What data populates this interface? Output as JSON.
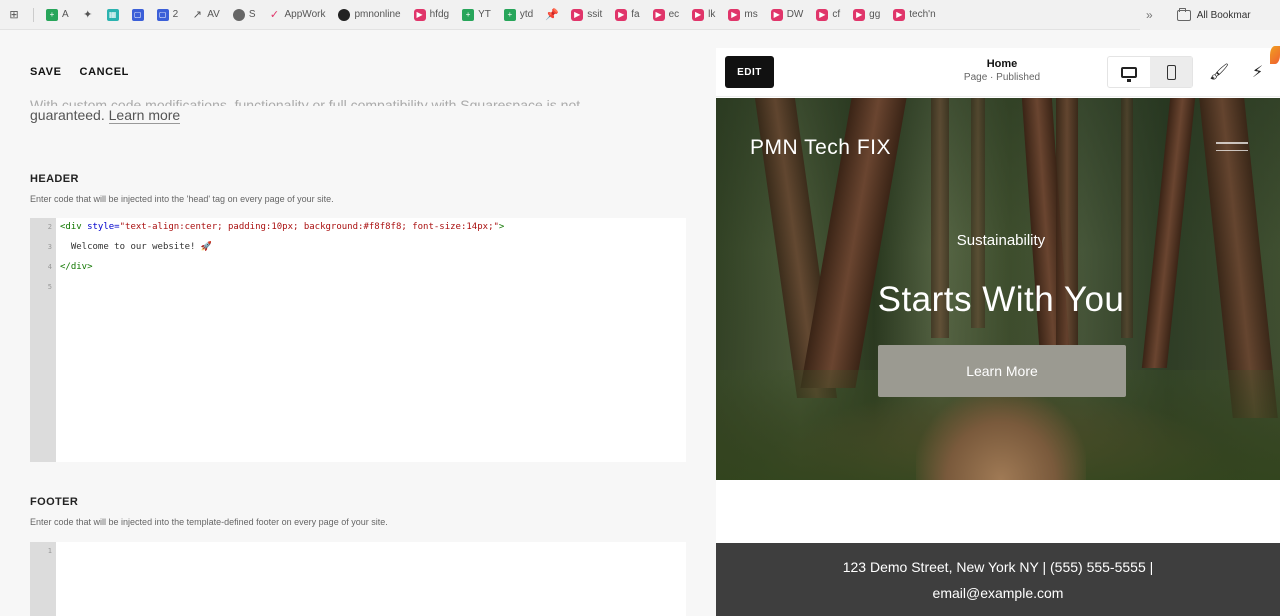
{
  "bookmarks": [
    {
      "label": "",
      "icon": "apps-icon",
      "kind": "gray",
      "glyph": "⊞"
    },
    {
      "label": "A",
      "icon": "sheets-icon",
      "kind": "green",
      "glyph": "+"
    },
    {
      "label": "",
      "icon": "puzzle-icon",
      "kind": "gray",
      "glyph": "✦"
    },
    {
      "label": "",
      "icon": "teal-icon",
      "kind": "teal",
      "glyph": "▦"
    },
    {
      "label": "",
      "icon": "chat-icon",
      "kind": "blue",
      "glyph": "▢"
    },
    {
      "label": "2",
      "icon": "chat-icon",
      "kind": "blue",
      "glyph": "▢"
    },
    {
      "label": "AV",
      "icon": "trend-icon",
      "kind": "gray",
      "glyph": "↗"
    },
    {
      "label": "S",
      "icon": "globe-icon",
      "kind": "globe",
      "glyph": ""
    },
    {
      "label": "AppWork",
      "icon": "check-icon",
      "kind": "red",
      "glyph": "✓"
    },
    {
      "label": "pmnonline",
      "icon": "github-icon",
      "kind": "gh",
      "glyph": ""
    },
    {
      "label": "hfdg",
      "icon": "youtube-icon",
      "kind": "pink",
      "glyph": "▶"
    },
    {
      "label": "YT",
      "icon": "sheets-icon",
      "kind": "green",
      "glyph": "+"
    },
    {
      "label": "ytd",
      "icon": "sheets-icon",
      "kind": "green",
      "glyph": "+"
    },
    {
      "label": "",
      "icon": "pin-icon",
      "kind": "gray",
      "glyph": "📌"
    },
    {
      "label": "ssit",
      "icon": "youtube-icon",
      "kind": "pink",
      "glyph": "▶"
    },
    {
      "label": "fa",
      "icon": "youtube-icon",
      "kind": "pink",
      "glyph": "▶"
    },
    {
      "label": "ec",
      "icon": "youtube-icon",
      "kind": "pink",
      "glyph": "▶"
    },
    {
      "label": "lk",
      "icon": "youtube-icon",
      "kind": "pink",
      "glyph": "▶"
    },
    {
      "label": "ms",
      "icon": "youtube-icon",
      "kind": "pink",
      "glyph": "▶"
    },
    {
      "label": "DW",
      "icon": "youtube-icon",
      "kind": "pink",
      "glyph": "▶"
    },
    {
      "label": "cf",
      "icon": "youtube-icon",
      "kind": "pink",
      "glyph": "▶"
    },
    {
      "label": "gg",
      "icon": "youtube-icon",
      "kind": "pink",
      "glyph": "▶"
    },
    {
      "label": "tech'n",
      "icon": "youtube-icon",
      "kind": "pink",
      "glyph": "▶"
    }
  ],
  "bookmarks_overflow": "»",
  "all_bookmarks": "All Bookmar",
  "editor_panel": {
    "save": "SAVE",
    "cancel": "CANCEL",
    "intro_faded": "With custom code modifications, functionality or full compatibility with Squarespace is not",
    "intro_text": "guaranteed.",
    "learn_more": "Learn more",
    "header": {
      "title": "HEADER",
      "desc": "Enter code that will be injected into the 'head' tag on every page of your site.",
      "line_numbers": [
        "2",
        "3",
        "4",
        "5"
      ],
      "code_open": "<div style=\"text-align:center; padding:10px; background:#f8f8f8; font-size:14px;\">",
      "code_text": "  Welcome to our website! 🚀",
      "code_close": "</div>"
    },
    "footer": {
      "title": "FOOTER",
      "desc": "Enter code that will be injected into the template-defined footer on every page of your site.",
      "line_numbers": [
        "1"
      ]
    }
  },
  "preview": {
    "edit": "EDIT",
    "page_title": "Home",
    "page_status": "Page · Published",
    "site_title": "PMN Tech FIX",
    "eyebrow": "Sustainability",
    "headline": "Starts With You",
    "cta": "Learn More",
    "footer_line1": "123 Demo Street, New York NY   |   (555) 555-5555   |",
    "footer_line2": "email@example.com"
  }
}
